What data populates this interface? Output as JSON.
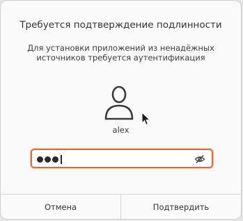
{
  "dialog": {
    "title": "Требуется подтверждение подлинности",
    "message": "Для установки приложений из ненадёжных источников требуется аутентификация",
    "username": "alex",
    "password_field": {
      "masked_char_count": 3,
      "reveal_icon": "eye-slash-icon"
    },
    "buttons": {
      "cancel_label": "Отмена",
      "confirm_label": "Подтвердить"
    },
    "icons": {
      "avatar": "user-avatar-icon",
      "cursor": "mouse-pointer-icon"
    },
    "colors": {
      "accent_focus": "#e0683b",
      "background": "#fafafa",
      "text": "#333333"
    }
  }
}
